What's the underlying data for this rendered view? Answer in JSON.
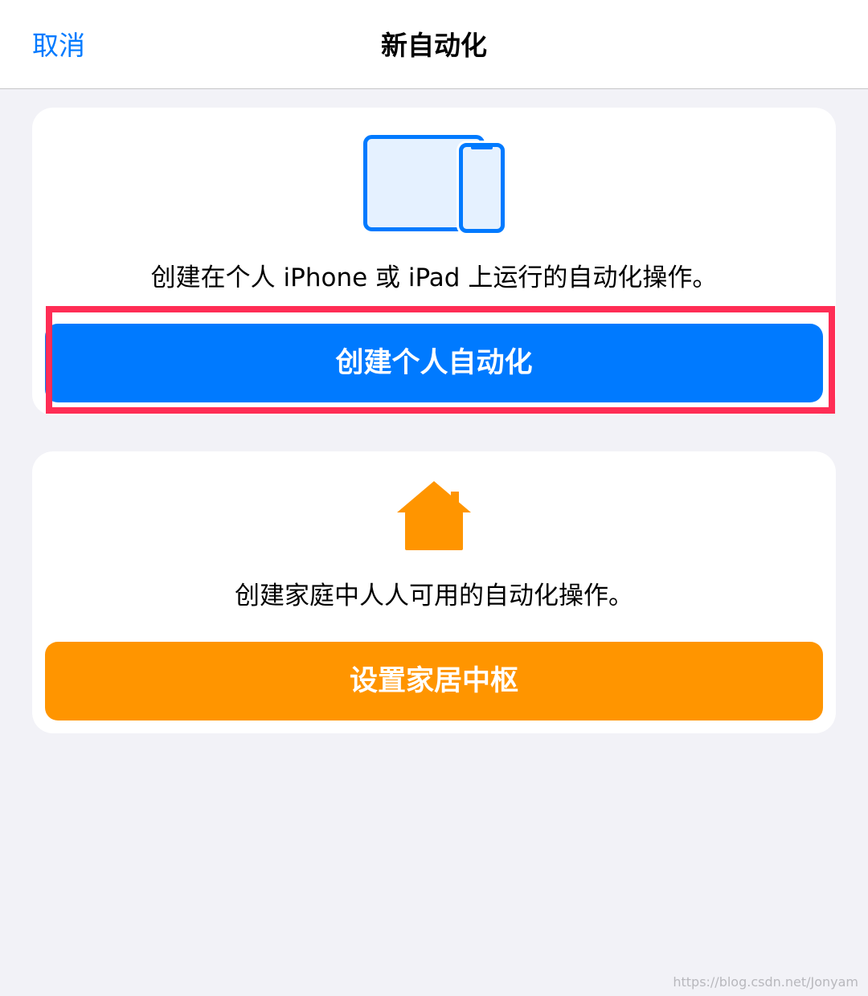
{
  "header": {
    "cancel_label": "取消",
    "title": "新自动化"
  },
  "personal_card": {
    "icon": "ipad-iphone-icon",
    "description": "创建在个人 iPhone 或 iPad 上运行的自动化操作。",
    "button_label": "创建个人自动化",
    "button_color": "#007aff"
  },
  "home_card": {
    "icon": "home-icon",
    "description": "创建家庭中人人可用的自动化操作。",
    "button_label": "设置家居中枢",
    "button_color": "#ff9500"
  },
  "annotation": {
    "highlight_color": "#ff2d55"
  },
  "watermark": "https://blog.csdn.net/Jonyam"
}
